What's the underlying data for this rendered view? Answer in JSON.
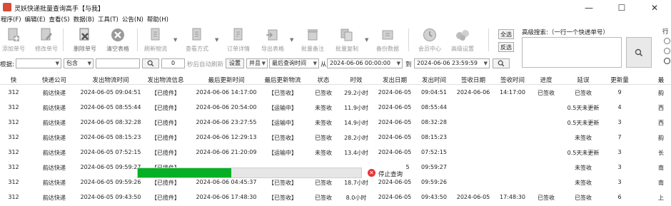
{
  "window": {
    "title": "灵妖快递批量查询高手【与我】",
    "min": "—",
    "max": "☐",
    "close": "✕"
  },
  "menu": [
    "程序(F)",
    "编辑(E)",
    "查看(S)",
    "数据(B)",
    "工具(T)",
    "公告(N)",
    "帮助(H)"
  ],
  "toolbar": {
    "add": "添加单号",
    "modify": "修改单号",
    "delete": "删除单号",
    "clear": "清空表格",
    "refresh": "刷新物流",
    "view": "查看方式",
    "order_detail": "订单详情",
    "export": "导出表格",
    "batch_note": "批量备注",
    "batch_copy": "批量复制",
    "backup": "备份数据",
    "member": "会员中心",
    "advanced": "高级设置",
    "select_all": "全选",
    "invert": "反选"
  },
  "advanced_search": {
    "label": "高级搜索:（一行一个快递单号）",
    "value": ""
  },
  "right_panel": {
    "label": "行"
  },
  "filter": {
    "by_label": "根据:",
    "field_value": "",
    "match_value": "包含",
    "keyword": "",
    "interval": "0",
    "auto_refresh_label": "秒后自动刷新",
    "settings": "设置",
    "and_value": "并且",
    "time_field": "最后查询时间",
    "from_label": "从",
    "from_value": "2024-06-06 00:00:00",
    "to_label": "到",
    "to_value": "2024-06-06 23:59:59"
  },
  "table": {
    "columns": [
      "快",
      "快递公司",
      "发出物流时间",
      "发出物流信息",
      "最后更新时间",
      "最后更新物流",
      "状态",
      "时效",
      "发出日期",
      "发出时间",
      "签收日期",
      "签收时间",
      "进度",
      "延误",
      "更新量",
      "最"
    ],
    "rows": [
      [
        "312",
        "韵达快递",
        "2024-06-05 09:04:51",
        "【已揽件】",
        "2024-06-06 14:17:00",
        "【已签收】",
        "已签收",
        "29.2小时",
        "2024-06-05",
        "09:04:51",
        "2024-06-06",
        "14:17:00",
        "已签收",
        "已签收",
        "9",
        "韵"
      ],
      [
        "312",
        "韵达快递",
        "2024-06-05 08:55:44",
        "【已揽件】",
        "2024-06-06 20:54:00",
        "【运输中】",
        "未签收",
        "11.9小时",
        "2024-06-05",
        "08:55:44",
        "",
        "",
        "",
        "0.5天未更新",
        "4",
        "西"
      ],
      [
        "312",
        "韵达快递",
        "2024-06-05 08:32:28",
        "【已揽件】",
        "2024-06-06 23:27:55",
        "【运输中】",
        "未签收",
        "14.9小时",
        "2024-06-05",
        "08:32:28",
        "",
        "",
        "",
        "0.5天未更新",
        "3",
        "西"
      ],
      [
        "312",
        "韵达快递",
        "2024-06-05 08:15:23",
        "【已揽件】",
        "2024-06-06 12:29:13",
        "【已签收】",
        "已签收",
        "28.2小时",
        "2024-06-05",
        "08:15:23",
        "",
        "",
        "",
        "未签收",
        "7",
        "韵"
      ],
      [
        "312",
        "韵达快递",
        "2024-06-05 07:52:15",
        "【已揽件】",
        "2024-06-06 21:20:09",
        "【运输中】",
        "未签收",
        "13.4小时",
        "2024-06-05",
        "07:52:15",
        "",
        "",
        "",
        "0.5天未更新",
        "3",
        "长"
      ],
      [
        "312",
        "韵达快递",
        "2024-06-05 09:59:27",
        "【已揽件】",
        "",
        "",
        "",
        "",
        "5",
        "09:59:27",
        "",
        "",
        "",
        "未签收",
        "3",
        "南"
      ],
      [
        "312",
        "韵达快递",
        "2024-06-05 09:59:26",
        "【已揽件】",
        "2024-06-06 04:45:37",
        "【已签收】",
        "已签收",
        "18.7小时",
        "2024-06-05",
        "09:59:26",
        "",
        "",
        "",
        "未签收",
        "3",
        "南"
      ],
      [
        "312",
        "韵达快递",
        "2024-06-05 09:43:50",
        "【已揽件】",
        "2024-06-06 17:48:30",
        "【已签收】",
        "已签收",
        "8.0小时",
        "2024-06-05",
        "09:43:50",
        "2024-06-05",
        "17:48:30",
        "已签收",
        "已签收",
        "6",
        "上"
      ]
    ]
  },
  "progress": {
    "fraction": 0.42,
    "stop_label": "停止查询",
    "fill_color": "#06b025"
  }
}
